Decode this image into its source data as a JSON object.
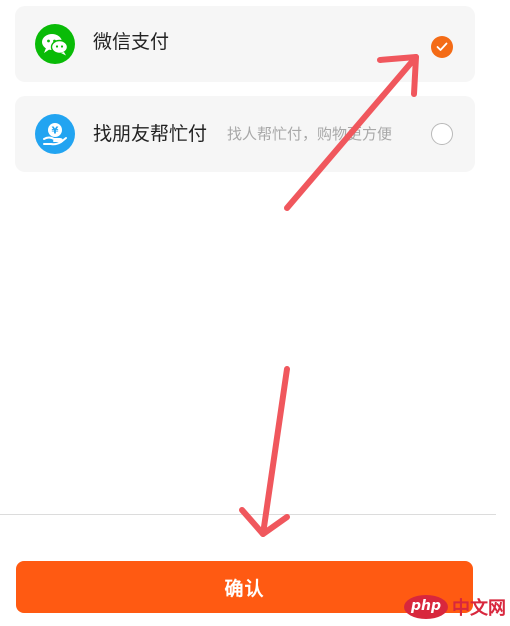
{
  "payment_options": [
    {
      "label": "微信支付",
      "icon": "wechat-pay-icon",
      "selected": true
    },
    {
      "label": "找朋友帮忙付",
      "sublabel": "找人帮忙付，购物更方便",
      "icon": "friend-pay-icon",
      "selected": false
    }
  ],
  "confirm": {
    "label": "确认"
  },
  "watermark": {
    "badge": "php",
    "text": "中文网"
  },
  "colors": {
    "accent": "#ff5a12",
    "check": "#f46b16",
    "wechat_green": "#09bb07",
    "friend_blue": "#22a4f1",
    "annotation_arrow": "#f0575d",
    "watermark_red": "#d8273d"
  }
}
